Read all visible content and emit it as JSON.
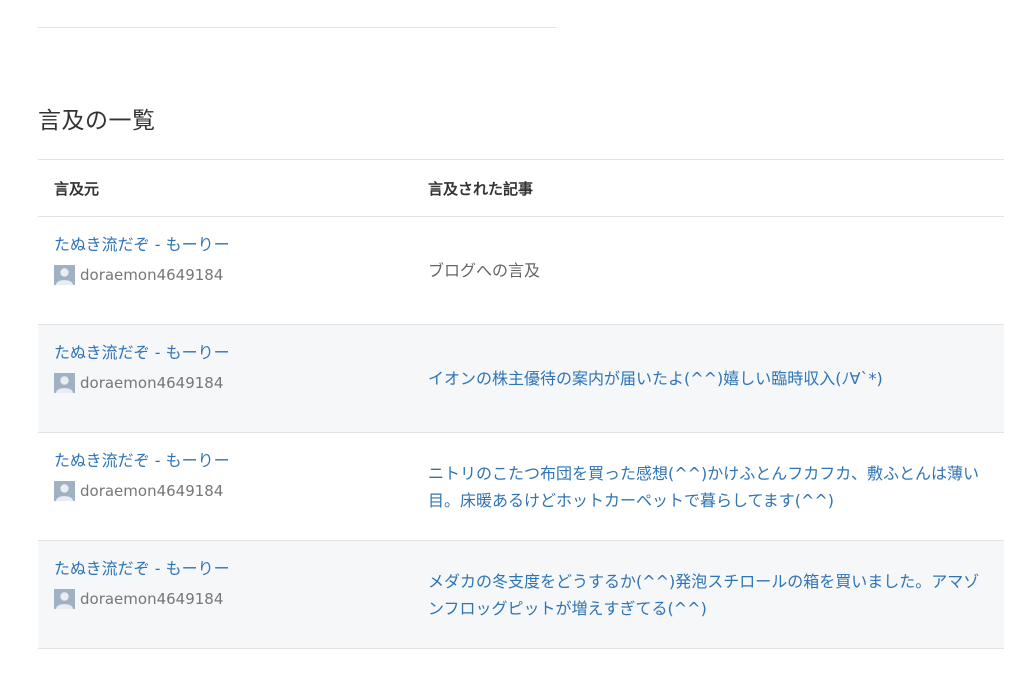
{
  "section": {
    "title": "言及の一覧"
  },
  "table": {
    "headers": {
      "source": "言及元",
      "article": "言及された記事"
    },
    "rows": [
      {
        "source_title": "たぬき流だぞ - もーりー",
        "user": "doraemon4649184",
        "article_lines": [
          "ブログへの言及"
        ],
        "is_link": false
      },
      {
        "source_title": "たぬき流だぞ - もーりー",
        "user": "doraemon4649184",
        "article_lines": [
          "イオンの株主優待の案内が届いたよ(^^)嬉しい臨時収入(ﾉ∀`*)"
        ],
        "is_link": true
      },
      {
        "source_title": "たぬき流だぞ - もーりー",
        "user": "doraemon4649184",
        "article_lines": [
          "ニトリのこたつ布団を買った感想(^^)かけふとんフカフカ、敷ふとんは薄い",
          "目。床暖あるけどホットカーペットで暮らしてます(^^)"
        ],
        "is_link": true
      },
      {
        "source_title": "たぬき流だぞ - もーりー",
        "user": "doraemon4649184",
        "article_lines": [
          "メダカの冬支度をどうするか(^^)発泡スチロールの箱を買いました。アマゾ",
          "ンフロッグピットが増えすぎてる(^^)"
        ],
        "is_link": true
      }
    ]
  },
  "icons": {
    "avatar": "user-avatar-icon"
  },
  "colors": {
    "link": "#2f74b5",
    "row_alt_background": "#f5f7f9",
    "muted_text": "#777777"
  }
}
